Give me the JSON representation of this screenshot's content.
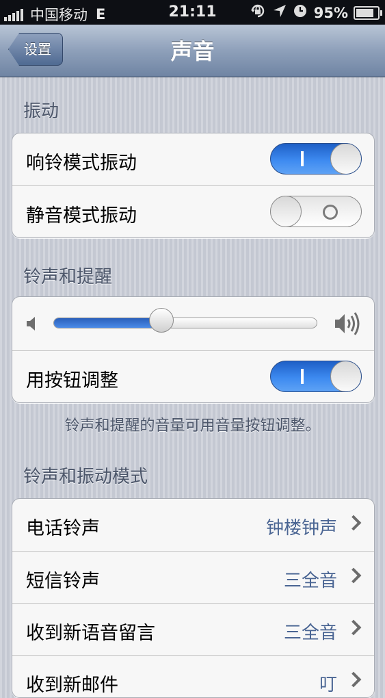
{
  "status_bar": {
    "carrier": "中国移动",
    "network": "E",
    "time": "21:11",
    "battery_percent": "95%",
    "battery_level": 0.95,
    "icons": [
      "orientation-lock-icon",
      "location-arrow-icon",
      "clock-icon",
      "battery-charging-icon"
    ]
  },
  "nav": {
    "back_label": "设置",
    "title": "声音"
  },
  "vibrate": {
    "header": "振动",
    "rows": [
      {
        "label": "响铃模式振动",
        "on": true
      },
      {
        "label": "静音模式振动",
        "on": false
      }
    ]
  },
  "ringer": {
    "header": "铃声和提醒",
    "volume_level": 0.41,
    "adjust_label": "用按钮调整",
    "adjust_on": true,
    "footer": "铃声和提醒的音量可用音量按钮调整。"
  },
  "patterns": {
    "header": "铃声和振动模式",
    "rows": [
      {
        "label": "电话铃声",
        "value": "钟楼钟声"
      },
      {
        "label": "短信铃声",
        "value": "三全音"
      },
      {
        "label": "收到新语音留言",
        "value": "三全音"
      },
      {
        "label": "收到新邮件",
        "value": "叮"
      }
    ]
  },
  "colors": {
    "nav_bar": "#8ea0ba",
    "toggle_on": "#3d8af0",
    "value_text": "#4a6593"
  }
}
